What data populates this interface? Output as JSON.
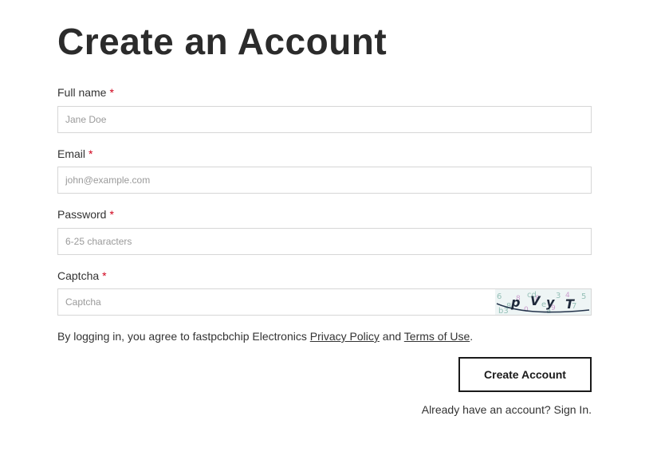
{
  "page": {
    "title": "Create an Account"
  },
  "form": {
    "full_name": {
      "label": "Full name",
      "required_mark": "*",
      "placeholder": "Jane Doe",
      "value": ""
    },
    "email": {
      "label": "Email",
      "required_mark": "*",
      "placeholder": "john@example.com",
      "value": ""
    },
    "password": {
      "label": "Password",
      "required_mark": "*",
      "placeholder": "6-25 characters",
      "value": ""
    },
    "captcha": {
      "label": "Captcha",
      "required_mark": "*",
      "placeholder": "Captcha",
      "value": "",
      "image_text": "PVYT"
    }
  },
  "agreement": {
    "prefix": "By logging in, you agree to fastpcbchip Electronics",
    "privacy_link": "Privacy Policy",
    "conjunction": "and",
    "terms_link": "Terms of Use",
    "suffix": "."
  },
  "submit": {
    "label": "Create Account"
  },
  "signin": {
    "prompt": "Already have an account?",
    "link": "Sign In."
  },
  "colors": {
    "required": "#d0021b",
    "text": "#333333",
    "border": "#d6d6d6",
    "button_border": "#1a1a1a"
  }
}
